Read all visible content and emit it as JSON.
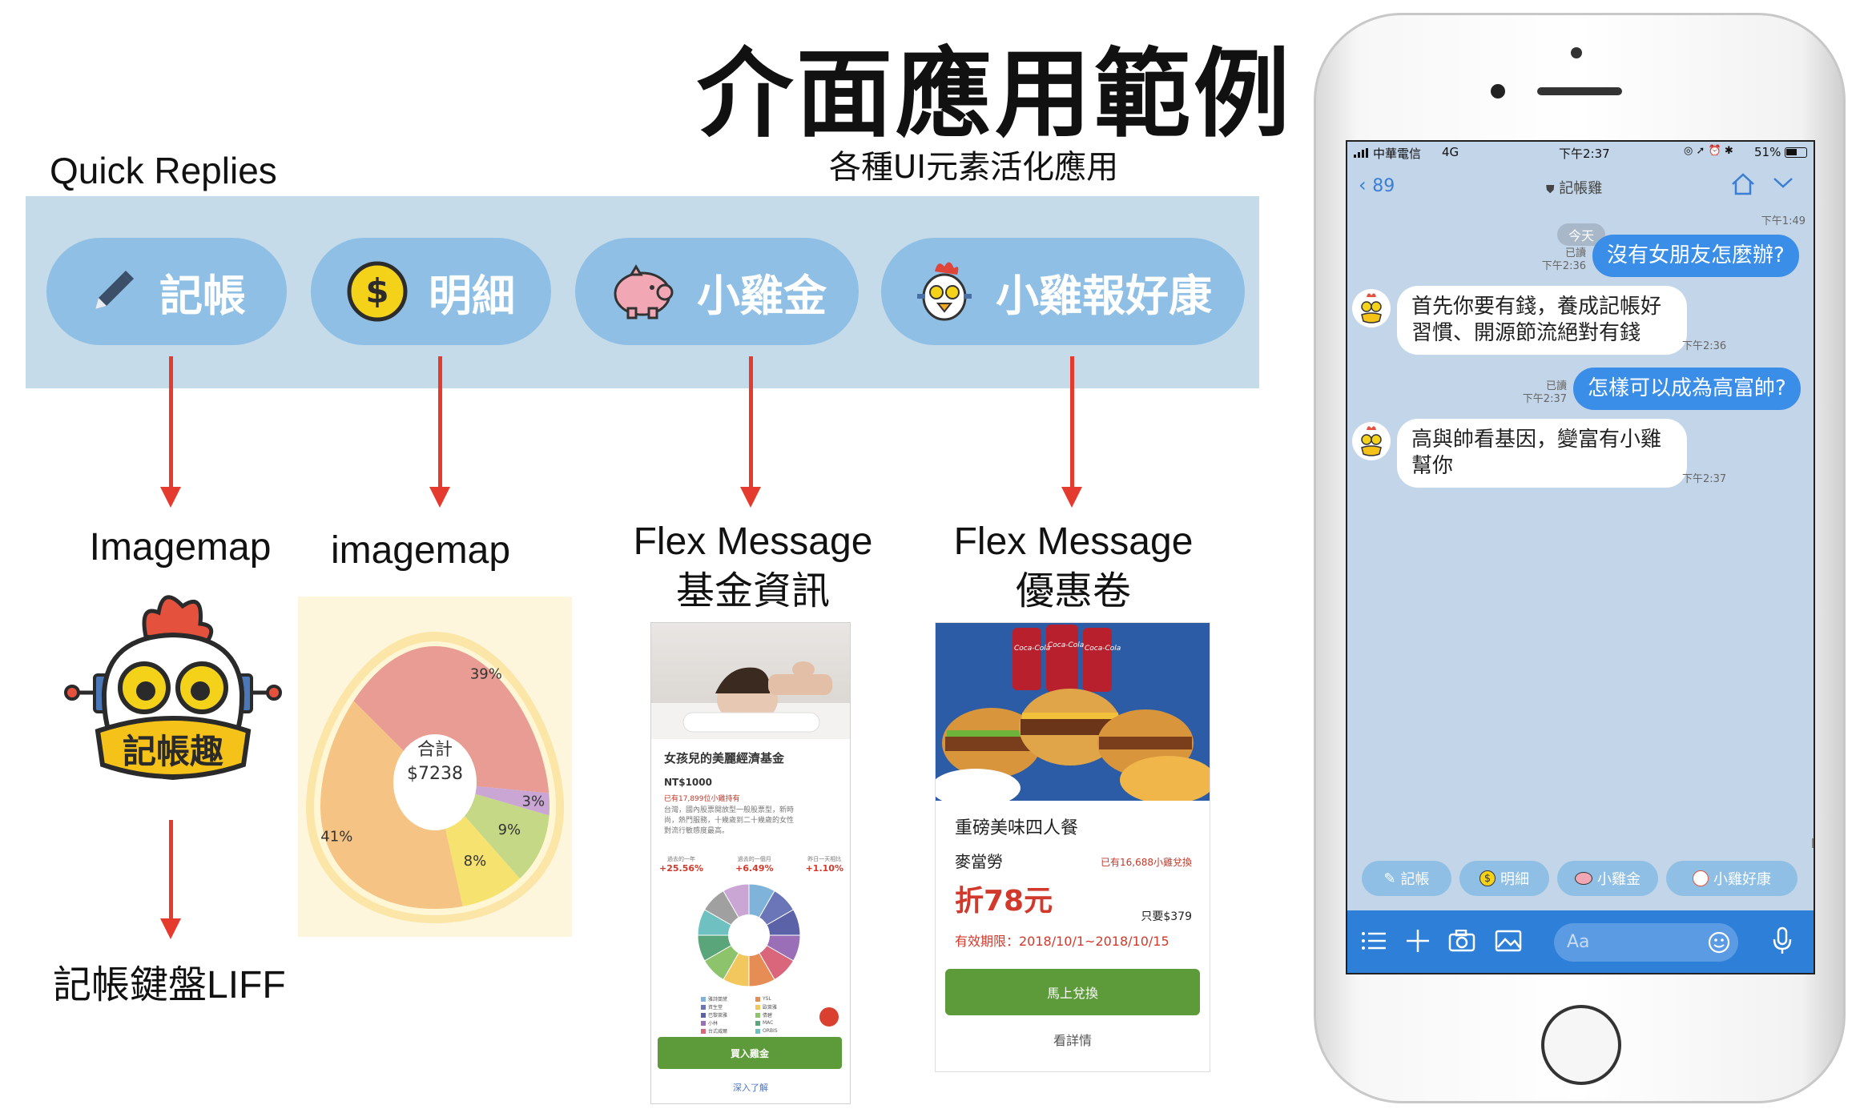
{
  "title": "介面應用範例",
  "subtitle": "各種UI元素活化應用",
  "quick_replies": {
    "label": "Quick Replies",
    "buttons": [
      "記帳",
      "明細",
      "小雞金",
      "小雞報好康"
    ]
  },
  "labels": {
    "imagemap1": "Imagemap",
    "imagemap2": "imagemap",
    "flex1_line1": "Flex Message",
    "flex1_line2": "基金資訊",
    "flex2_line1": "Flex Message",
    "flex2_line2": "優惠卷",
    "liff": "記帳鍵盤LIFF"
  },
  "logo_text": "記帳趣",
  "egg_chart": {
    "center_label": "合計",
    "total": "$7238"
  },
  "chart_data": {
    "type": "pie",
    "labels": [
      "39%",
      "3%",
      "9%",
      "8%",
      "41%"
    ],
    "values": [
      39,
      3,
      9,
      8,
      41
    ],
    "colors": [
      "#e89c93",
      "#c9a6d4",
      "#c5d886",
      "#f6e26e",
      "#f5c384"
    ]
  },
  "fund": {
    "title": "女孩兒的美麗經濟基金",
    "price": "NT$1000",
    "buyers": "已有17,899位小雞持有",
    "desc": [
      "台灣，國內股票開放型一般股票型，新時",
      "尚，熱門服務，十幾歲到二十幾歲的女性",
      "對流行敏感度最高。"
    ],
    "stats": [
      {
        "label": "過去的一年",
        "value": "+25.56%"
      },
      {
        "label": "過去的一個月",
        "value": "+6.49%"
      },
      {
        "label": "昨日一天相比",
        "value": "+1.10%"
      }
    ],
    "legend": [
      "雅詩蘭黛",
      "資生堂",
      "巴黎萊雅",
      "小林",
      "台式威爾",
      "YSL",
      "歐萊雅",
      "倩碧",
      "MAC",
      "ORBIS"
    ],
    "buy_button": "買入雞金",
    "more_link": "深入了解"
  },
  "coupon": {
    "brand_mark": "Coca-Cola",
    "title": "重磅美味四人餐",
    "store": "麥當勞",
    "redeemed": "已有16,688小雞兌換",
    "discount": "折78元",
    "price_note": "只要$379",
    "validity": "有效期限：2018/10/1~2018/10/15",
    "redeem_button": "馬上兌換",
    "detail_link": "看詳情"
  },
  "phone": {
    "status": {
      "carrier": "中華電信",
      "network": "4G",
      "time": "下午2:37",
      "battery": "51%"
    },
    "nav": {
      "back_count": "89",
      "chat_name": "記帳雞"
    },
    "header_time": "下午1:49",
    "date_chip": "今天",
    "messages": [
      {
        "side": "right",
        "text": "沒有女朋友怎麼辦?",
        "read": "已讀",
        "time": "下午2:36"
      },
      {
        "side": "left",
        "lines": [
          "首先你要有錢，養成記帳好",
          "習慣、開源節流絕對有錢"
        ],
        "time": "下午2:36"
      },
      {
        "side": "right",
        "text": "怎樣可以成為高富帥?",
        "read": "已讀",
        "time": "下午2:37"
      },
      {
        "side": "left",
        "lines": [
          "高與帥看基因，變富有小雞",
          "幫你"
        ],
        "time": "下午2:37"
      }
    ],
    "quick_replies": [
      "記帳",
      "明細",
      "小雞金",
      "小雞好康"
    ],
    "input_placeholder": "Aa"
  }
}
